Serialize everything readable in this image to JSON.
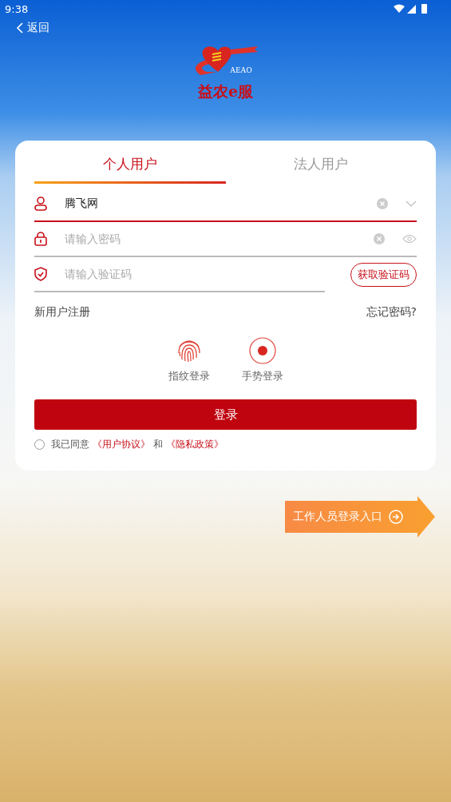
{
  "status_bar": {
    "time": "9:38"
  },
  "back": {
    "label": "返回"
  },
  "logo": {
    "latin": "AEAO",
    "name": "益农e服"
  },
  "tabs": [
    {
      "label": "个人用户",
      "selected": true
    },
    {
      "label": "法人用户",
      "selected": false
    }
  ],
  "username": {
    "value": "腾飞网"
  },
  "password": {
    "placeholder": "请输入密码"
  },
  "code": {
    "placeholder": "请输入验证码",
    "button": "获取验证码"
  },
  "links": {
    "register": "新用户注册",
    "forgot": "忘记密码?"
  },
  "quick_login": [
    {
      "kind": "fingerprint",
      "label": "指纹登录"
    },
    {
      "kind": "gesture",
      "label": "手势登录"
    }
  ],
  "login_button": "登录",
  "agreement": {
    "checked": false,
    "prefix": "我已同意",
    "terms": "《用户协议》",
    "and": "和",
    "privacy": "《隐私政策》"
  },
  "staff_entry": {
    "label": "工作人员登录入口"
  }
}
